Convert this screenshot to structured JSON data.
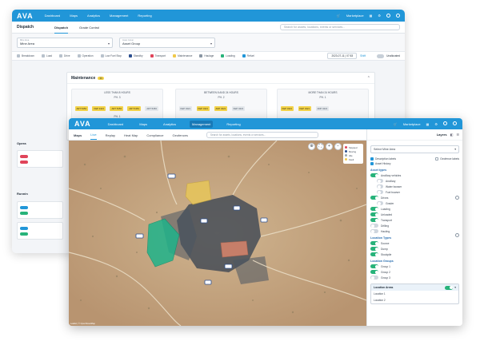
{
  "back_window": {
    "app_name": "AVA",
    "nav": [
      "Dashboard",
      "Maps",
      "Analytics",
      "Management",
      "Reporting"
    ],
    "marketplace": "Marketplace",
    "page_title": "Dispatch",
    "tabs": [
      "Dispatch",
      "Grade Control"
    ],
    "search_placeholder": "Search for assets, locations, events or services...",
    "filter_mine_label": "Mine Area",
    "filter_mine_value": "Mine Area",
    "filter_group_label": "Asset Group",
    "filter_group_value": "Asset Group",
    "legend": [
      "Breakdown",
      "Load",
      "Drive",
      "Operation",
      "Low Fuel Stop",
      "Standby",
      "Transport",
      "Maintenance",
      "Haulage",
      "Loading",
      "Refuel"
    ],
    "date": "2023-07-11 | 07:53",
    "date_action": "Shift",
    "unassign_label": "Unallocated",
    "maintenance": {
      "title": "Maintenance",
      "count": "11",
      "columns": [
        {
          "title": "LESS THAN 8 HOURS",
          "sub": "PH. 3",
          "chips": [
            "ART 5453",
            "KEP 3421",
            "ART 5453",
            "ART 5453",
            "ART 5453"
          ],
          "sub2": "PH. 1",
          "chips2": [
            "ART 5453",
            "ART 5453"
          ]
        },
        {
          "title": "BETWEEN 8 AND 24 HOURS",
          "sub": "PH. 2",
          "chips": [
            "KEP 3421",
            "KEP 3421",
            "ADP 3421",
            "KEP 3421"
          ]
        },
        {
          "title": "MORE THAN 24 HOURS",
          "sub": "PH. 1",
          "chips": [
            "KEP 3421",
            "KEP 3421",
            "ADP 3421"
          ]
        }
      ]
    },
    "operators_label": "Opera",
    "running_label": "Runnin"
  },
  "front_window": {
    "app_name": "AVA",
    "nav": [
      "Dashboard",
      "Maps",
      "Analytics",
      "Management",
      "Reporting"
    ],
    "active_nav": "Management",
    "marketplace": "Marketplace",
    "tabs": [
      "Maps",
      "Live",
      "Replay",
      "Heat Map",
      "Compliance",
      "Geofences"
    ],
    "search_placeholder": "Search for assets, locations, events or services...",
    "map_legend": [
      {
        "label": "Stopped",
        "color": "#e0445a"
      },
      {
        "label": "Moving",
        "color": "#2c4f8f"
      },
      {
        "label": "Idle",
        "color": "#9aa6b2"
      },
      {
        "label": "Fault",
        "color": "#f0c94a"
      }
    ],
    "map_footer": "Leaflet | © OpenStreetMap",
    "layers": {
      "title": "Layers",
      "area_select": "Select Mine Area",
      "checkbox_desc": "Description labels",
      "checkbox_asset": "Asset History",
      "checkbox_geofence": "Geofence labels",
      "asset_types_title": "Asset types",
      "asset_types": [
        {
          "label": "Ancillary vehicles",
          "on": true,
          "indent": false
        },
        {
          "label": "Ancillary",
          "on": false,
          "indent": true
        },
        {
          "label": "Water bowser",
          "on": false,
          "indent": true
        },
        {
          "label": "Fuel bowser",
          "on": false,
          "indent": true
        },
        {
          "label": "Drives",
          "on": true,
          "indent": false
        },
        {
          "label": "Grader",
          "on": false,
          "indent": true
        },
        {
          "label": "Loading",
          "on": true,
          "indent": false
        },
        {
          "label": "Unloaded",
          "on": true,
          "indent": false
        },
        {
          "label": "Transport",
          "on": true,
          "indent": false
        },
        {
          "label": "Drilling",
          "on": false,
          "indent": false
        },
        {
          "label": "Hauling",
          "on": false,
          "indent": false
        }
      ],
      "location_types_title": "Location Types",
      "location_types": [
        {
          "label": "Source",
          "on": true
        },
        {
          "label": "Dump",
          "on": true
        },
        {
          "label": "Stockpile",
          "on": true
        }
      ],
      "location_groups_title": "Location Groups",
      "location_groups": [
        {
          "label": "Group 1",
          "on": true
        },
        {
          "label": "Group 2",
          "on": true
        },
        {
          "label": "Group 3",
          "on": false
        }
      ],
      "location_areas_title": "Location Areas",
      "location_areas": [
        "Location 1",
        "Location 2"
      ]
    }
  }
}
